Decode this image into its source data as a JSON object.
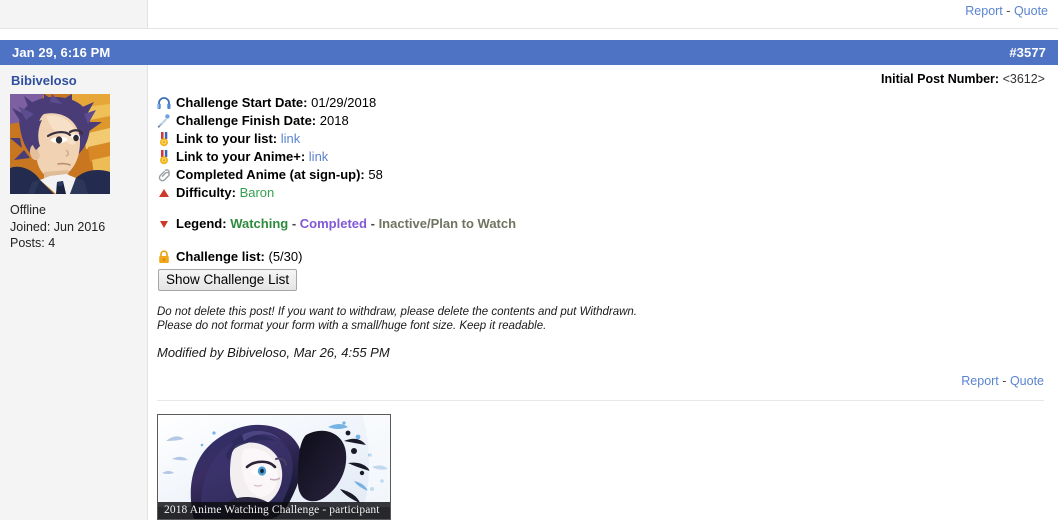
{
  "previous_post": {
    "report_label": "Report",
    "separator": "-",
    "quote_label": "Quote"
  },
  "post_header": {
    "date": "Jan 29, 6:16 PM",
    "post_number": "#3577"
  },
  "sidebar": {
    "username": "Bibiveloso",
    "avatar_name": "user-avatar",
    "status": "Offline",
    "joined": "Joined: Jun 2016",
    "posts": "Posts: 4"
  },
  "content": {
    "initial_post_label": "Initial Post Number:",
    "initial_post_value": "<3612>",
    "form": [
      {
        "icon": "headphones-icon",
        "label": "Challenge Start Date:",
        "value": "01/29/2018",
        "type": "text"
      },
      {
        "icon": "microphone-icon",
        "label": "Challenge Finish Date:",
        "value": "2018",
        "type": "text"
      },
      {
        "icon": "medal-icon",
        "label": "Link to your list:",
        "value": "link",
        "type": "link"
      },
      {
        "icon": "medal-icon",
        "label": "Link to your Anime+:",
        "value": "link",
        "type": "link"
      },
      {
        "icon": "paperclip-icon",
        "label": "Completed Anime (at sign-up):",
        "value": "58",
        "type": "text"
      },
      {
        "icon": "red-triangle-icon",
        "label": "Difficulty:",
        "value": "Baron",
        "type": "green"
      }
    ],
    "legend": {
      "icon": "red-triangle-down-icon",
      "label": "Legend:",
      "watching": "Watching",
      "completed": "Completed",
      "inactive": "Inactive/Plan to Watch",
      "dash": "-"
    },
    "challenge_list": {
      "icon": "lock-icon",
      "label": "Challenge list:",
      "count": "(5/30)",
      "button_label": "Show Challenge List"
    },
    "notes": [
      "Do not delete this post! If you want to withdraw, please delete the contents and put Withdrawn.",
      "Please do not format your form with a small/huge font size. Keep it readable."
    ],
    "modified": "Modified by Bibiveloso, Mar 26, 4:55 PM",
    "actions": {
      "report_label": "Report",
      "separator": "-",
      "quote_label": "Quote"
    },
    "signature": {
      "image_name": "signature-banner-image",
      "caption": "2018 Anime Watching Challenge  - participant"
    }
  },
  "colors": {
    "header_blue": "#4e72c4",
    "link_blue": "#5b84d0",
    "username_blue": "#2f4f9e",
    "sidebar_bg": "#f4f4f4",
    "green": "#36a052",
    "purple": "#8259d6"
  }
}
